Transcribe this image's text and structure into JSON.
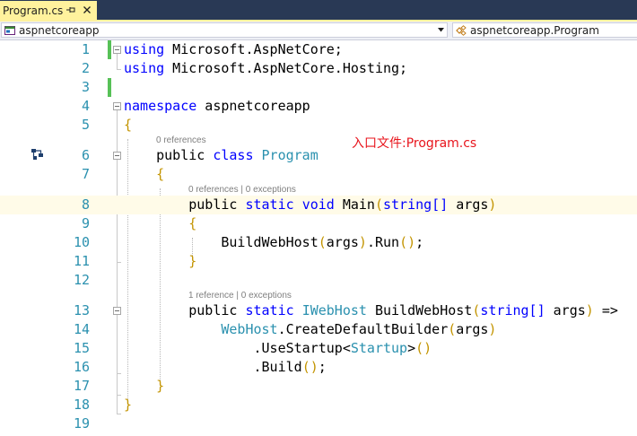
{
  "tab": {
    "title": "Program.cs"
  },
  "navbar": {
    "project": "aspnetcoreapp",
    "scope": "aspnetcoreapp.Program"
  },
  "annotation": "入口文件:Program.cs",
  "codelens": {
    "program_class": "0 references",
    "main_method": "0 references | 0 exceptions",
    "buildwebhost_method": "1 reference | 0 exceptions"
  },
  "line_numbers": [
    "1",
    "2",
    "3",
    "4",
    "5",
    "6",
    "7",
    "8",
    "9",
    "10",
    "11",
    "12",
    "13",
    "14",
    "15",
    "16",
    "17",
    "18",
    "19"
  ],
  "code": {
    "l1_kw": "using",
    "l1_rest": " Microsoft.AspNetCore;",
    "l2_kw": "using",
    "l2_rest": " Microsoft.AspNetCore.Hosting;",
    "l4_kw": "namespace",
    "l4_rest": " aspnetcoreapp",
    "l5_brace": "{",
    "l6_public": "public",
    "l6_class": "class",
    "l6_name": "Program",
    "l7_brace": "{",
    "l8_public": "public",
    "l8_static": "static",
    "l8_void": "void",
    "l8_name": "Main",
    "l8_open": "(",
    "l8_type": "string[]",
    "l8_arg": " args",
    "l8_close": ")",
    "l9_brace": "{",
    "l10_call": "BuildWebHost",
    "l10_open": "(",
    "l10_arg": "args",
    "l10_close": ")",
    "l10_run": ".Run",
    "l10_parens": "()",
    "l10_semi": ";",
    "l11_brace": "}",
    "l13_public": "public",
    "l13_static": "static",
    "l13_type": "IWebHost",
    "l13_name": " BuildWebHost",
    "l13_open": "(",
    "l13_ptype": "string[]",
    "l13_arg": " args",
    "l13_close": ")",
    "l13_arrow": " =>",
    "l14_type": "WebHost",
    "l14_call": ".CreateDefaultBuilder",
    "l14_open": "(",
    "l14_arg": "args",
    "l14_close": ")",
    "l15_call": ".UseStartup",
    "l15_lt": "<",
    "l15_type": "Startup",
    "l15_gt": ">",
    "l15_parens": "()",
    "l16_call": ".Build",
    "l16_parens": "()",
    "l16_semi": ";",
    "l17_brace": "}",
    "l18_brace": "}"
  },
  "colors": {
    "keyword": "#0000ff",
    "type": "#2b91af",
    "brace": "#c39400",
    "line_number": "#2b91af",
    "annotation": "#e8141c",
    "tab_active": "#fff29d",
    "tab_strip": "#293955"
  },
  "icons": {
    "class_margin": "class-hierarchy-icon",
    "lightbulb": "lightbulb-icon",
    "project": "csharp-project-icon",
    "class": "class-icon"
  }
}
